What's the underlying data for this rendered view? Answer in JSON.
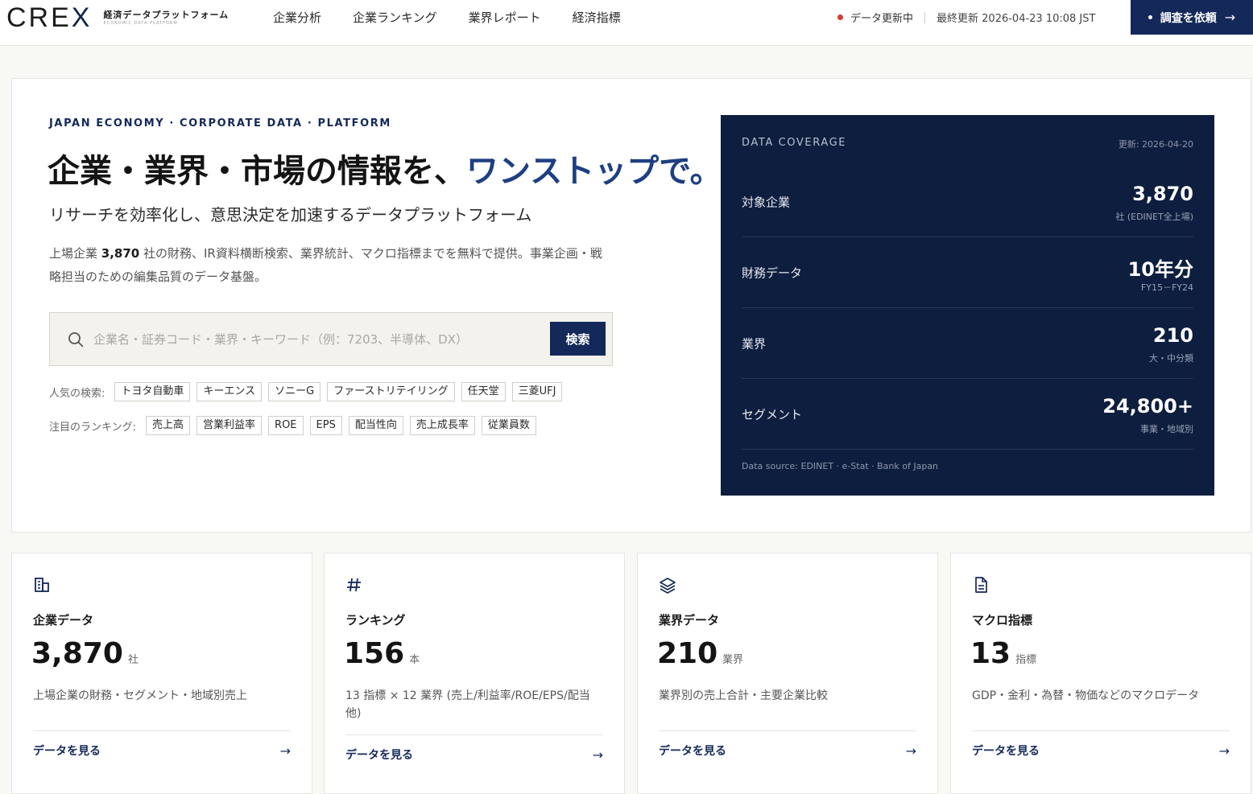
{
  "header": {
    "logo_mark": "CREX",
    "logo_jp": "経済データプラットフォーム",
    "logo_en": "ECONOMIC DATA PLATFORM",
    "nav": [
      "企業分析",
      "企業ランキング",
      "業界レポート",
      "経済指標"
    ],
    "status_label": "データ更新中",
    "last_updated": "最終更新 2026-04-23 10:08 JST",
    "cta_label": "調査を依頼",
    "cta_arrow": "→"
  },
  "hero": {
    "kicker": "JAPAN ECONOMY · CORPORATE DATA · PLATFORM",
    "headline_main": "企業・業界・市場の情報を、",
    "headline_highlight": "ワンストップで。",
    "subhead": "リサーチを効率化し、意思決定を加速するデータプラットフォーム",
    "desc_pre": "上場企業 ",
    "desc_count": "3,870",
    "desc_post": " 社の財務、IR資料横断検索、業界統計、マクロ指標までを無料で提供。事業企画・戦略担当のための編集品質のデータ基盤。",
    "search_placeholder": "企業名・証券コード・業界・キーワード（例：7203、半導体、DX）",
    "search_button": "検索",
    "popular_label": "人気の検索:",
    "popular": [
      "トヨタ自動車",
      "キーエンス",
      "ソニーG",
      "ファーストリテイリング",
      "任天堂",
      "三菱UFJ"
    ],
    "ranking_label": "注目のランキング:",
    "rankings": [
      "売上高",
      "営業利益率",
      "ROE",
      "EPS",
      "配当性向",
      "売上成長率",
      "従業員数"
    ]
  },
  "coverage": {
    "title": "DATA COVERAGE",
    "date": "更新: 2026-04-20",
    "rows": [
      {
        "label": "対象企業",
        "value": "3,870",
        "sub": "社 (EDINET全上場)"
      },
      {
        "label": "財務データ",
        "value": "10年分",
        "sub": "FY15－FY24"
      },
      {
        "label": "業界",
        "value": "210",
        "sub": "大・中分類"
      },
      {
        "label": "セグメント",
        "value": "24,800+",
        "sub": "事業・地域別"
      }
    ],
    "source": "Data source: EDINET · e-Stat · Bank of Japan"
  },
  "cards": [
    {
      "icon": "building-icon",
      "title": "企業データ",
      "value": "3,870",
      "unit": "社",
      "desc": "上場企業の財務・セグメント・地域別売上",
      "link": "データを見る"
    },
    {
      "icon": "hash-icon",
      "title": "ランキング",
      "value": "156",
      "unit": "本",
      "desc": "13 指標 × 12 業界 (売上/利益率/ROE/EPS/配当他)",
      "link": "データを見る"
    },
    {
      "icon": "layers-icon",
      "title": "業界データ",
      "value": "210",
      "unit": "業界",
      "desc": "業界別の売上合計・主要企業比較",
      "link": "データを見る"
    },
    {
      "icon": "document-icon",
      "title": "マクロ指標",
      "value": "13",
      "unit": "指標",
      "desc": "GDP・金利・為替・物価などのマクロデータ",
      "link": "データを見る"
    }
  ],
  "colors": {
    "brand_navy": "#14295a",
    "panel_bg": "#0d1e3f",
    "accent_blue": "#1e3f82",
    "status_red": "#d63a32"
  }
}
